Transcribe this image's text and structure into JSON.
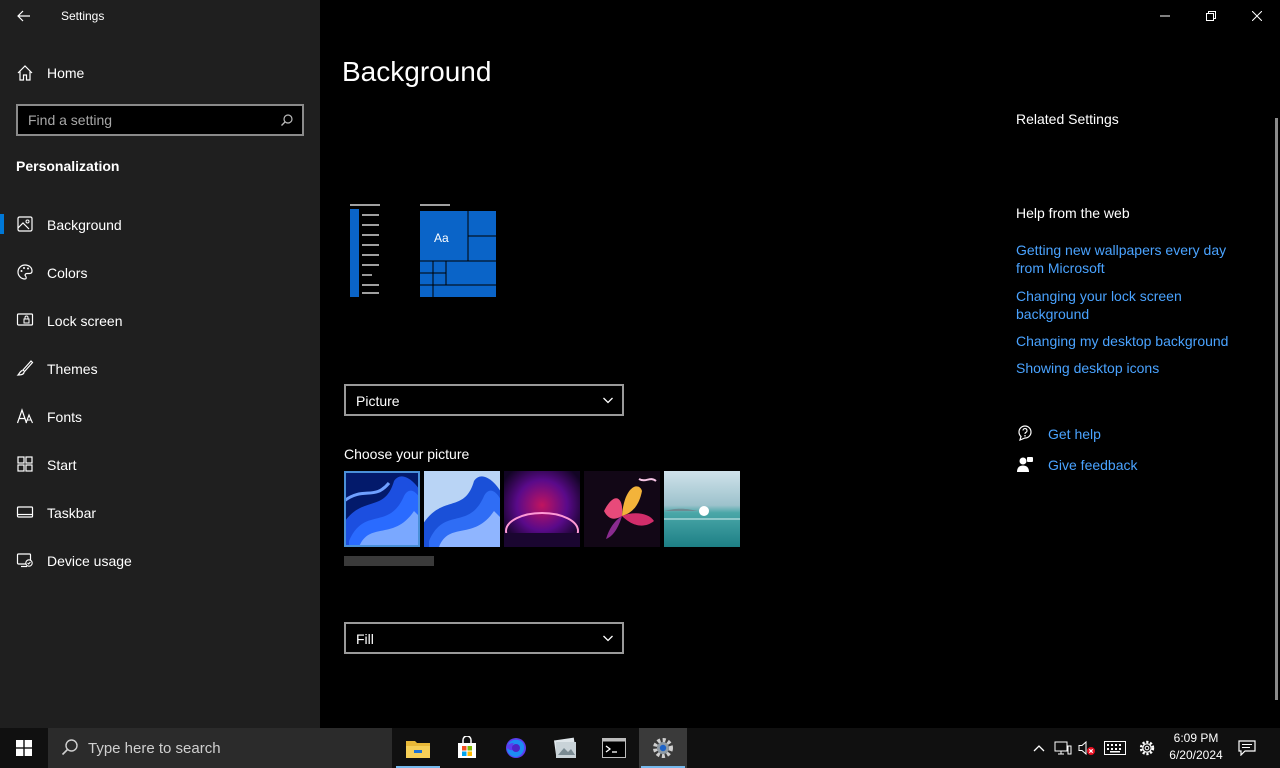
{
  "window": {
    "title": "Settings"
  },
  "sidebar": {
    "home_label": "Home",
    "search_placeholder": "Find a setting",
    "section_title": "Personalization",
    "items": [
      {
        "label": "Background",
        "icon": "image-icon"
      },
      {
        "label": "Colors",
        "icon": "palette-icon"
      },
      {
        "label": "Lock screen",
        "icon": "lock-screen-icon"
      },
      {
        "label": "Themes",
        "icon": "brush-icon"
      },
      {
        "label": "Fonts",
        "icon": "fonts-icon"
      },
      {
        "label": "Start",
        "icon": "start-icon"
      },
      {
        "label": "Taskbar",
        "icon": "taskbar-icon"
      },
      {
        "label": "Device usage",
        "icon": "device-usage-icon"
      }
    ],
    "active_index": 0
  },
  "main": {
    "title": "Background",
    "preview_tile_text": "Aa",
    "background_dropdown": {
      "value": "Picture"
    },
    "choose_label": "Choose your picture",
    "fit_dropdown": {
      "value": "Fill"
    }
  },
  "related": {
    "title": "Related Settings",
    "help_title": "Help from the web",
    "links": [
      "Getting new wallpapers every day from Microsoft",
      "Changing your lock screen background",
      "Changing my desktop background",
      "Showing desktop icons"
    ],
    "get_help": "Get help",
    "give_feedback": "Give feedback"
  },
  "taskbar": {
    "search_placeholder": "Type here to search",
    "time": "6:09 PM",
    "date": "6/20/2024",
    "apps": [
      "file-explorer-icon",
      "microsoft-store-icon",
      "firefox-icon",
      "photos-icon",
      "terminal-icon",
      "settings-gear-icon"
    ]
  },
  "colors": {
    "accent": "#0078d7",
    "link": "#4aa3ff",
    "sidebar_bg": "#1f1f1f"
  }
}
